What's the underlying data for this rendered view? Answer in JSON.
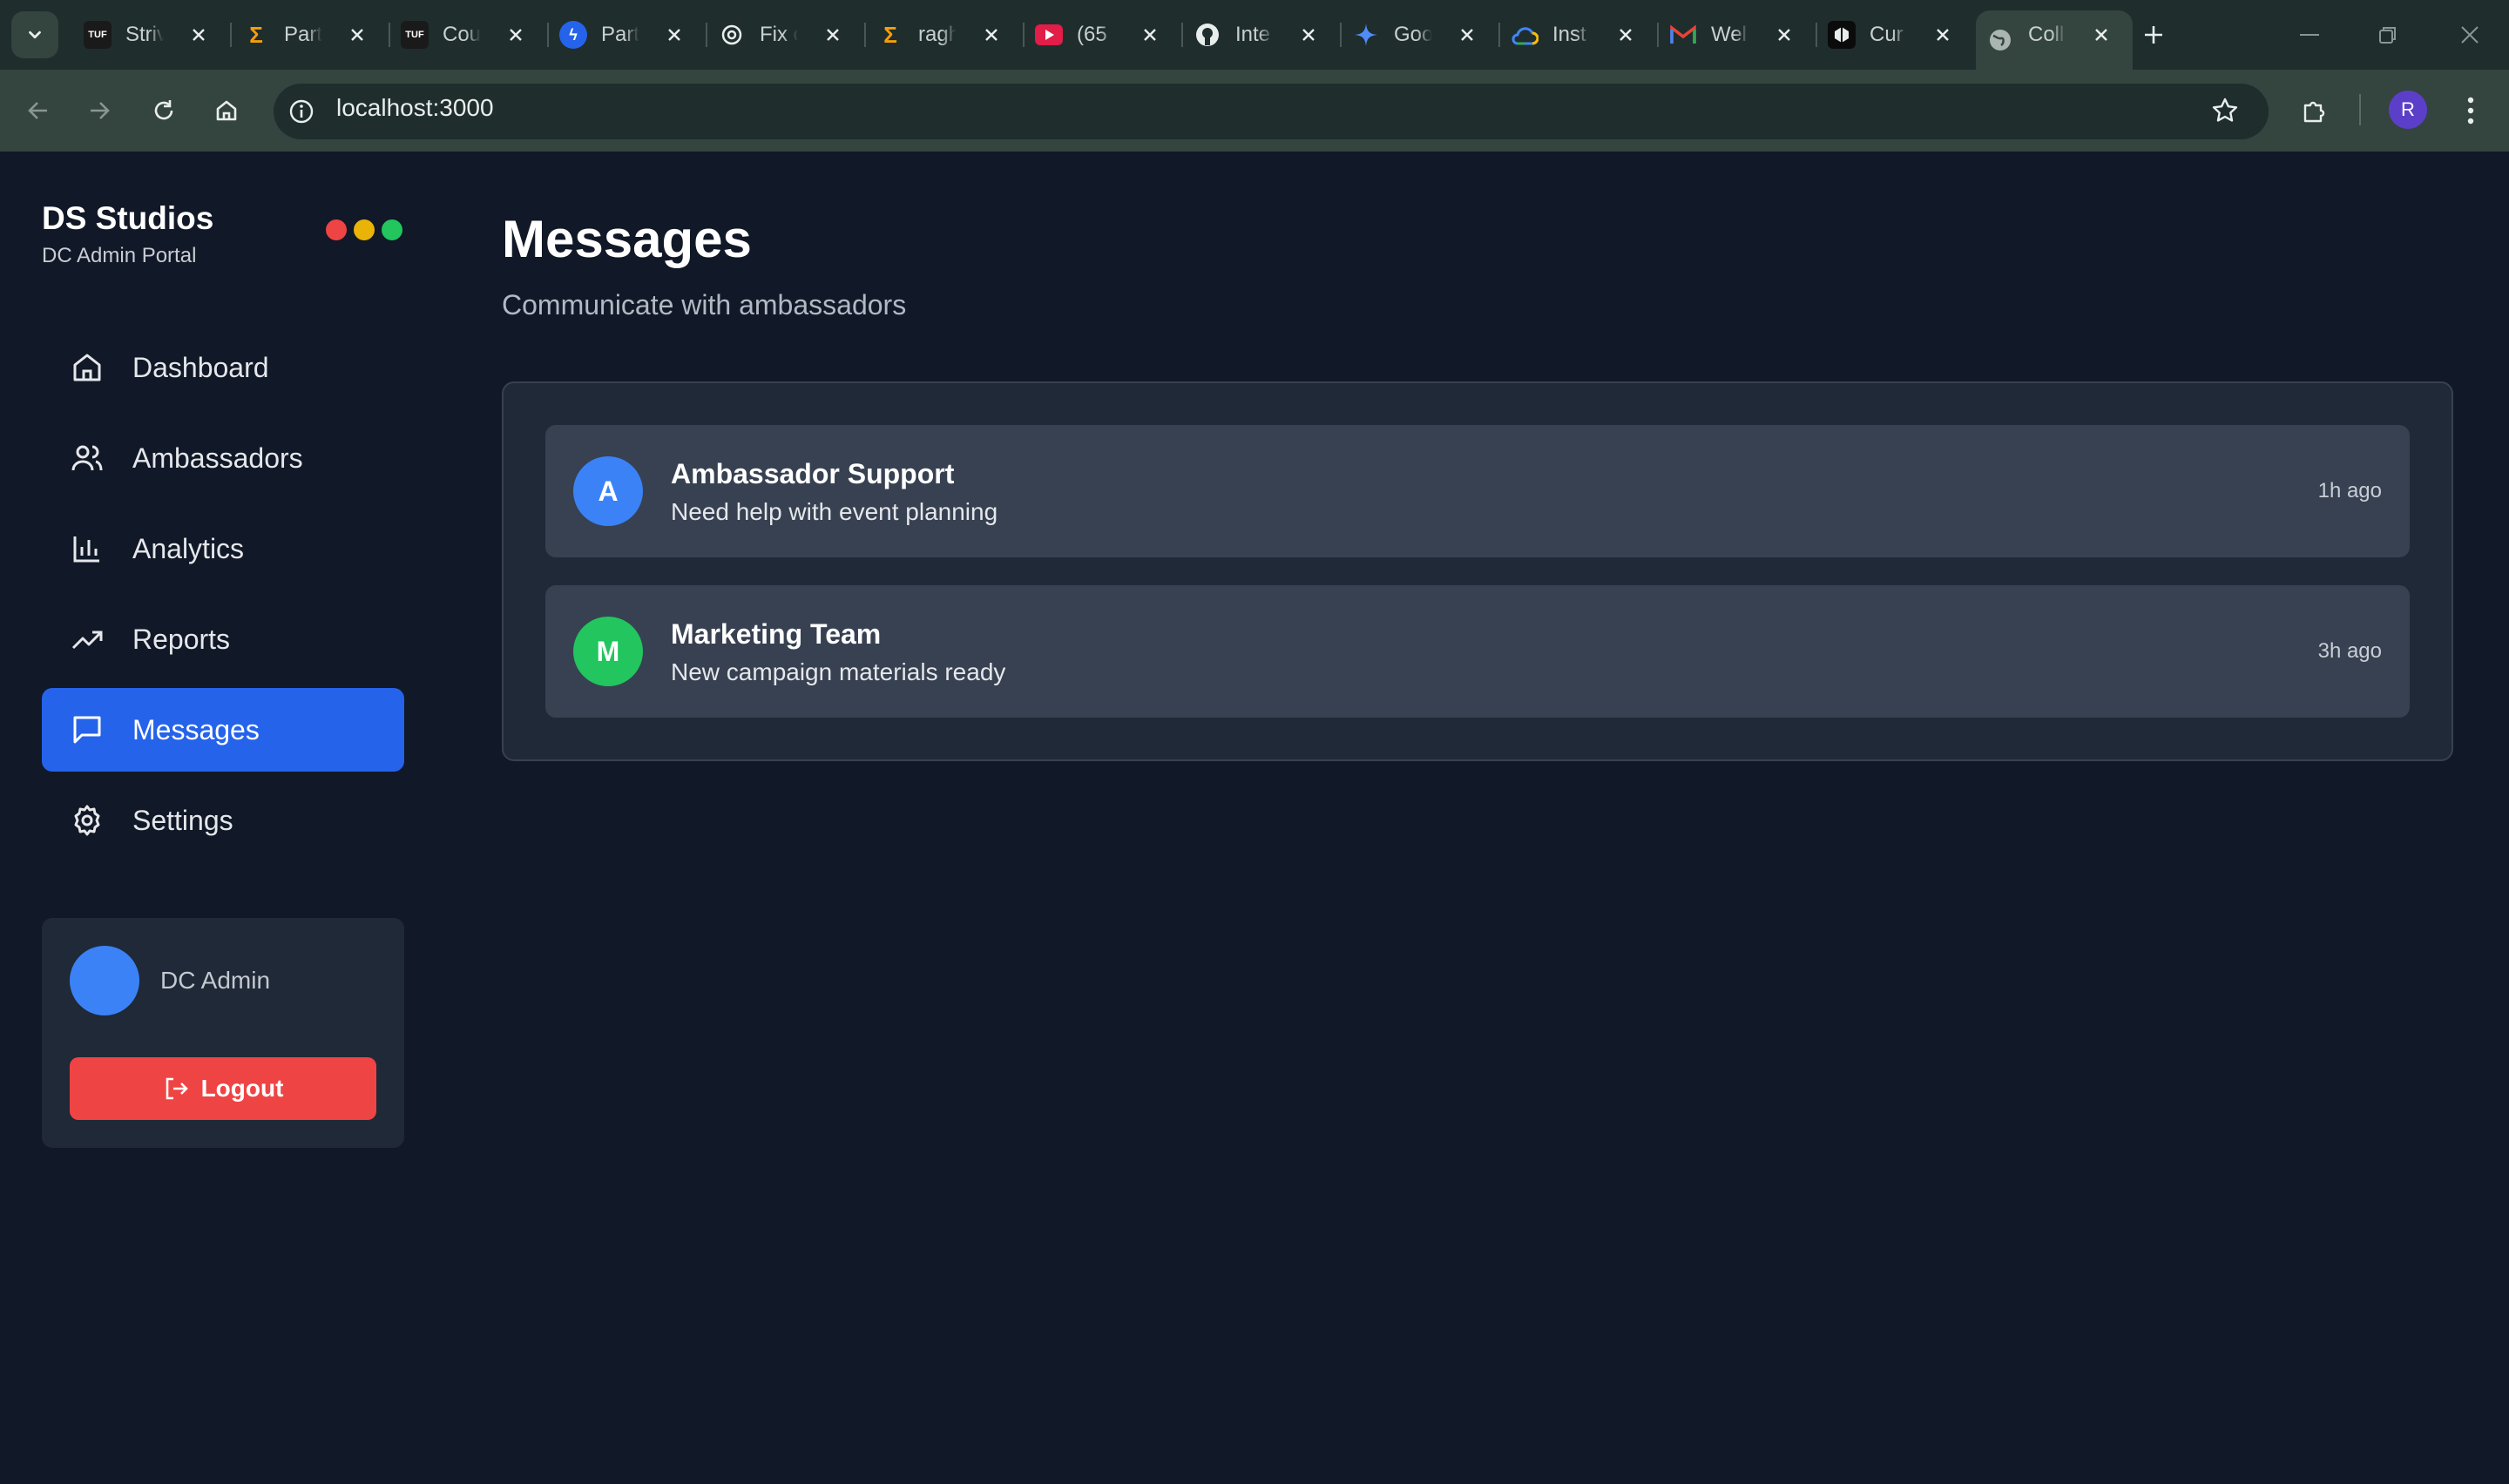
{
  "browser": {
    "tabs": [
      {
        "title": "Striver",
        "favicon": "TUF",
        "color": "#1a1a1a"
      },
      {
        "title": "Part",
        "favicon": "sigma",
        "color": "#1f2d2d"
      },
      {
        "title": "Cou",
        "favicon": "TUF",
        "color": "#1a1a1a"
      },
      {
        "title": "Part",
        "favicon": "bolt",
        "color": "#2563eb"
      },
      {
        "title": "Fix c",
        "favicon": "openai",
        "color": "#1f2d2d"
      },
      {
        "title": "ragh",
        "favicon": "sigma",
        "color": "#1f2d2d"
      },
      {
        "title": "(65",
        "favicon": "youtube",
        "color": "#e11d48"
      },
      {
        "title": "Inte",
        "favicon": "github",
        "color": "#1f2d2d"
      },
      {
        "title": "Goo",
        "favicon": "gemini",
        "color": "#1f2d2d"
      },
      {
        "title": "Inst",
        "favicon": "gcloud",
        "color": "#1f2d2d"
      },
      {
        "title": "Wel",
        "favicon": "gmail",
        "color": "#1f2d2d"
      },
      {
        "title": "Cur",
        "favicon": "cursor",
        "color": "#1a1a1a"
      },
      {
        "title": "Coll",
        "favicon": "globe",
        "color": "#34443f"
      }
    ],
    "url": "localhost:3000",
    "profile_initial": "R"
  },
  "sidebar": {
    "brand": "DS Studios",
    "subtitle": "DC Admin Portal",
    "window_dots": [
      "#ef4444",
      "#eab308",
      "#22c55e"
    ],
    "items": [
      {
        "label": "Dashboard",
        "icon": "home-icon"
      },
      {
        "label": "Ambassadors",
        "icon": "users-icon"
      },
      {
        "label": "Analytics",
        "icon": "bar-chart-icon"
      },
      {
        "label": "Reports",
        "icon": "trending-up-icon"
      },
      {
        "label": "Messages",
        "icon": "message-square-icon",
        "active": true
      },
      {
        "label": "Settings",
        "icon": "gear-icon"
      }
    ],
    "user": {
      "name": "DC Admin",
      "logout_label": "Logout"
    }
  },
  "main": {
    "title": "Messages",
    "subtitle": "Communicate with ambassadors",
    "messages": [
      {
        "initial": "A",
        "title": "Ambassador Support",
        "text": "Need help with event planning",
        "time": "1h ago",
        "color": "#3b82f6"
      },
      {
        "initial": "M",
        "title": "Marketing Team",
        "text": "New campaign materials ready",
        "time": "3h ago",
        "color": "#22c55e"
      }
    ]
  }
}
